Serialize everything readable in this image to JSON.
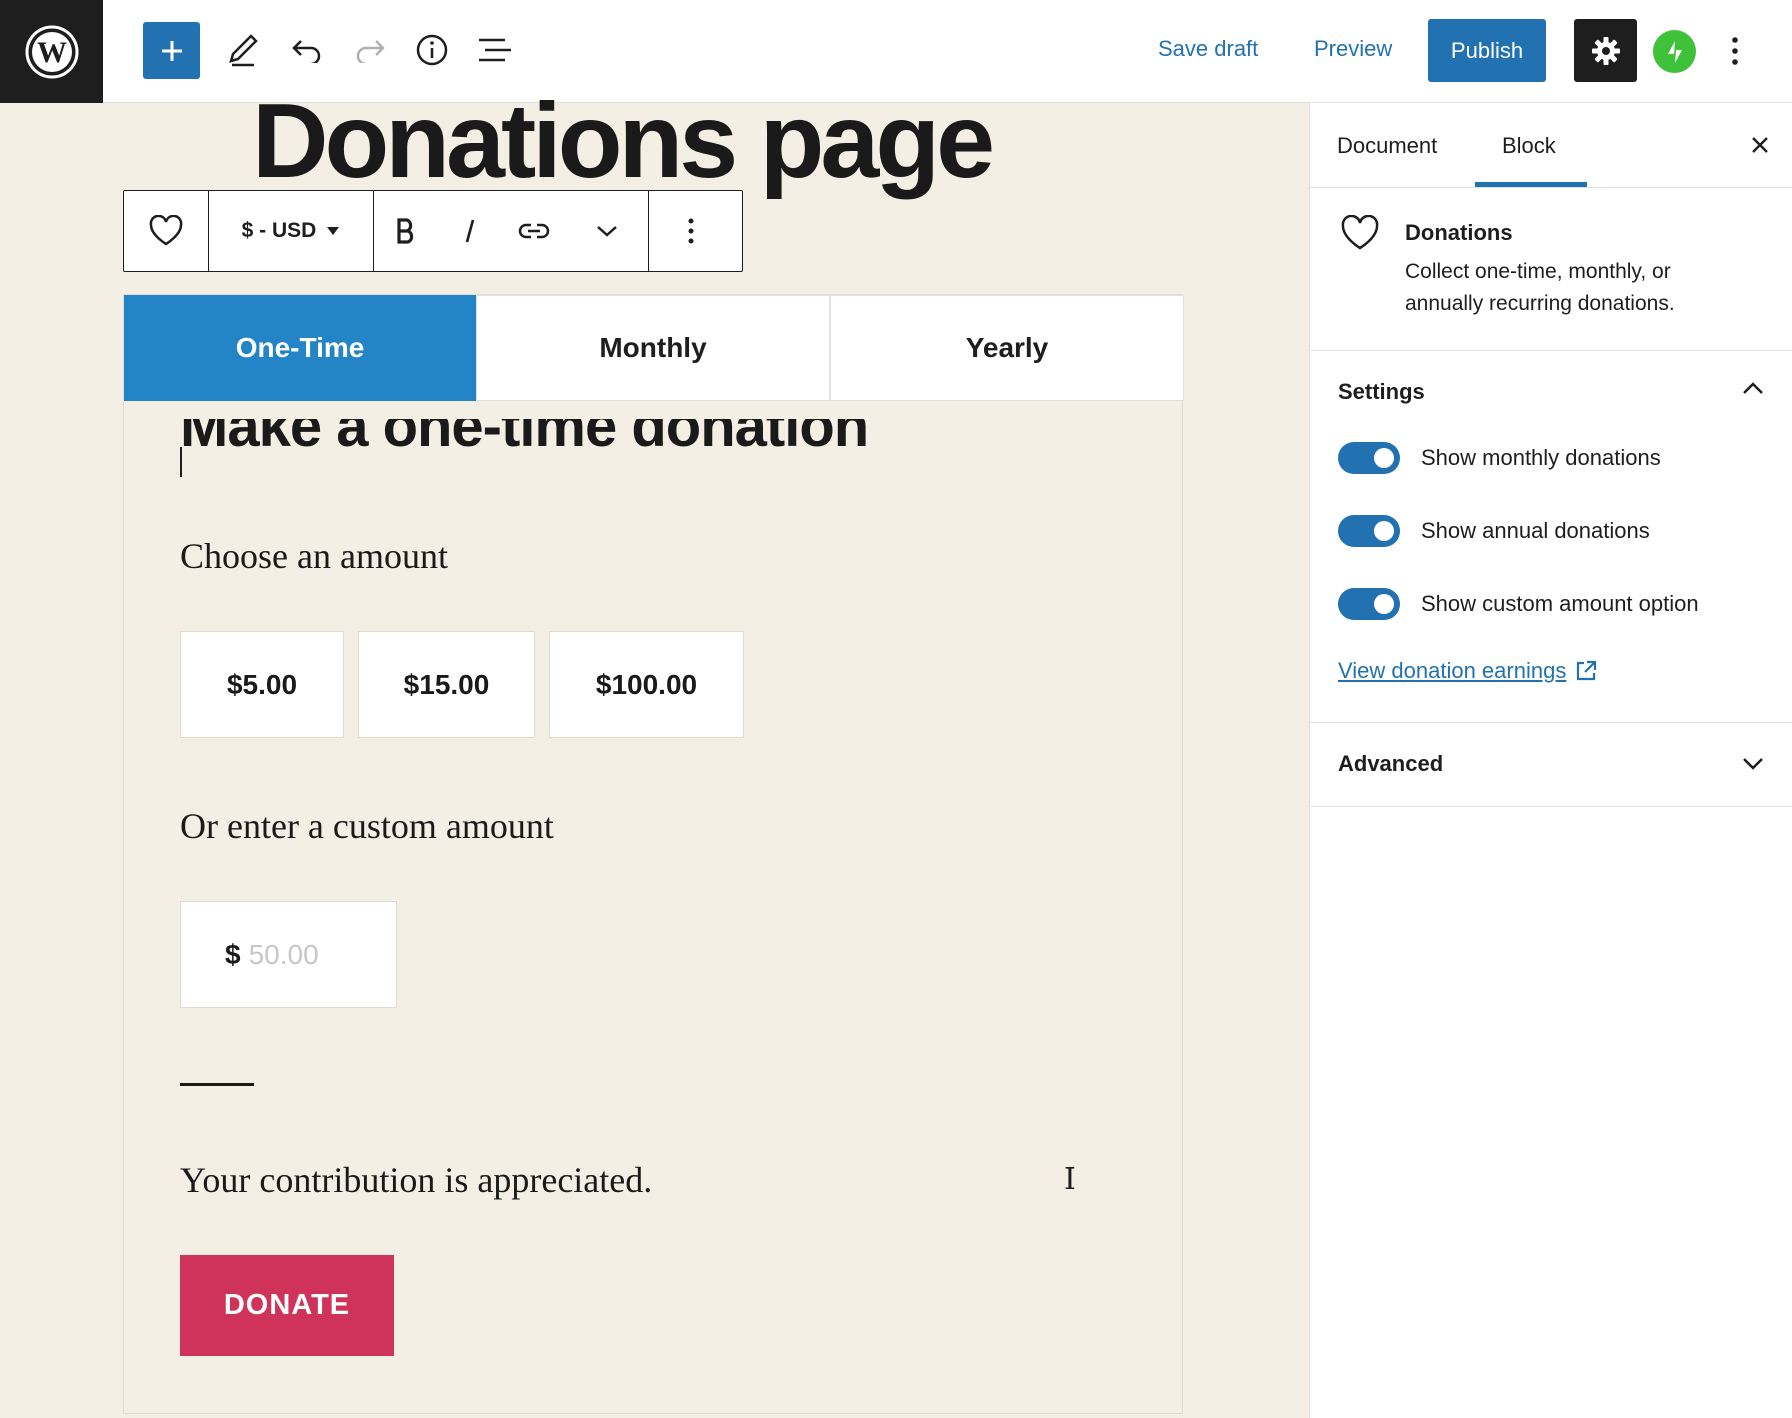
{
  "topbar": {
    "save_draft": "Save draft",
    "preview": "Preview",
    "publish": "Publish"
  },
  "editor": {
    "page_title": "Donations page",
    "toolbar": {
      "currency": "$ - USD"
    },
    "tabs": [
      {
        "label": "One-Time",
        "active": true
      },
      {
        "label": "Monthly",
        "active": false
      },
      {
        "label": "Yearly",
        "active": false
      }
    ],
    "heading": "Make a one-time donation",
    "choose_label": "Choose an amount",
    "amounts": [
      "$5.00",
      "$15.00",
      "$100.00"
    ],
    "custom_label": "Or enter a custom amount",
    "custom_currency": "$",
    "custom_placeholder": "50.00",
    "appreciate": "Your contribution is appreciated.",
    "donate": "DONATE"
  },
  "sidebar": {
    "tab_document": "Document",
    "tab_block": "Block",
    "block": {
      "title": "Donations",
      "description": "Collect one-time, monthly, or annually recurring donations."
    },
    "settings": {
      "header": "Settings",
      "toggles": [
        {
          "label": "Show monthly donations",
          "on": true
        },
        {
          "label": "Show annual donations",
          "on": true
        },
        {
          "label": "Show custom amount option",
          "on": true
        }
      ],
      "earnings_link": "View donation earnings"
    },
    "advanced": {
      "header": "Advanced"
    }
  },
  "colors": {
    "accent": "#2271b1",
    "tab_active": "#2384c6",
    "donate": "#cf3359",
    "canvas": "#f4efe4",
    "jetpack": "#3fc13a"
  }
}
